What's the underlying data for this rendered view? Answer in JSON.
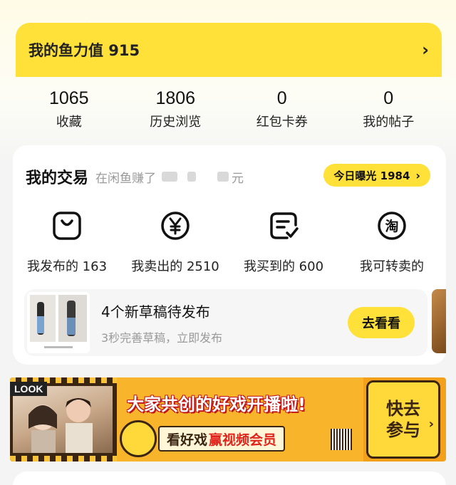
{
  "fish_value": {
    "label": "我的鱼力值 915",
    "arrow": "›"
  },
  "stats": [
    {
      "value": "1065",
      "label": "收藏"
    },
    {
      "value": "1806",
      "label": "历史浏览"
    },
    {
      "value": "0",
      "label": "红包卡券"
    },
    {
      "value": "0",
      "label": "我的帖子"
    }
  ],
  "trade": {
    "title": "我的交易",
    "subtitle": "在闲鱼赚了",
    "currency_suffix": "元",
    "exposure_label": "今日曝光 1984",
    "exposure_arrow": "›",
    "items": [
      {
        "icon": "bag-icon",
        "label": "我发布的 163"
      },
      {
        "icon": "yen-icon",
        "label": "我卖出的 2510"
      },
      {
        "icon": "receipt-check-icon",
        "label": "我买到的 600"
      },
      {
        "icon": "taobao-icon",
        "label": "我可转卖的",
        "glyph": "淘"
      }
    ],
    "draft": {
      "title": "4个新草稿待发布",
      "subtitle": "3秒完善草稿，立即发布",
      "button": "去看看"
    }
  },
  "promo": {
    "look_tag": "LOOK",
    "headline": "大家共创的好戏开播啦!",
    "sub_prefix": "看好戏",
    "sub_highlight": "赢视频会员",
    "cta_line1": "快去",
    "cta_line2": "参与",
    "cta_arrow": "›"
  },
  "colors": {
    "accent": "#ffe13a",
    "promo_orange": "#f3a11b",
    "muted_text": "#999999"
  }
}
